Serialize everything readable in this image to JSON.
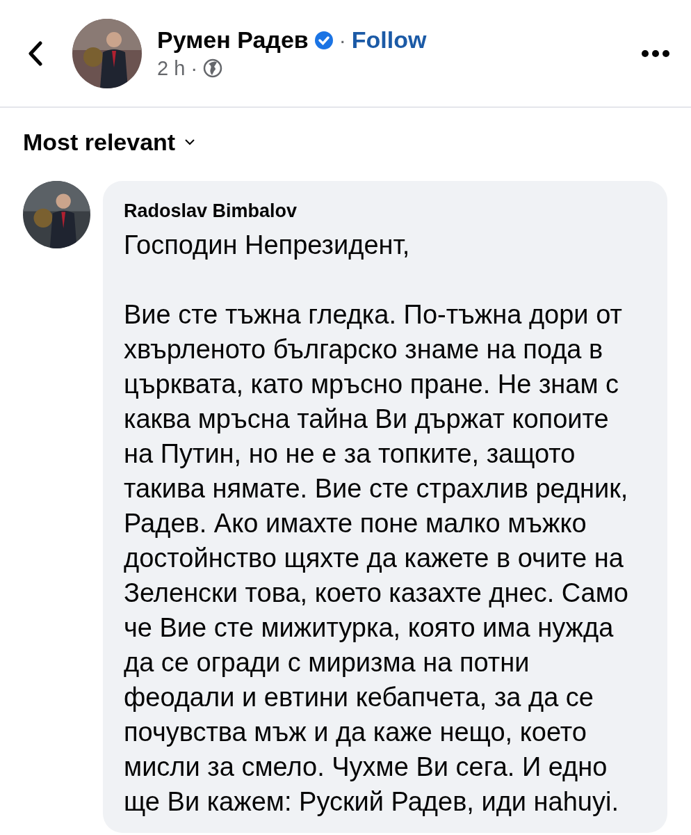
{
  "post_header": {
    "author": "Румен Радев",
    "verified": true,
    "separator": "·",
    "follow": "Follow",
    "time": "2 h",
    "time_separator": "·",
    "avatar": {
      "kind": "picture"
    }
  },
  "sort": {
    "label": "Most relevant"
  },
  "comments": [
    {
      "author": "Radoslav Bimbalov",
      "avatar": {
        "kind": "picture"
      },
      "paragraphs": [
        [
          "Господин Непрезидент,"
        ],
        [
          "Вие сте тъжна гледка. По-тъжна дори от",
          "хвърленото българско знаме на пода в",
          "църквата, като мръсно пране. Не знам с",
          "каква мръсна тайна Ви държат копоите",
          "на Путин, но не е за топките, защото",
          "такива нямате. Вие сте страхлив редник,",
          "Радев. Ако имахте поне малко мъжко",
          "достойнство щяхте да кажете в очите на",
          "Зеленски това, което казахте днес. Само",
          "че Вие сте мижитурка, която има нужда",
          "да се огради с миризма на потни",
          "феодали и евтини кебапчета, за да се",
          "почувства мъж и да каже нещо, което",
          "мисли за смело. Чухме Ви сега. И едно",
          "ще Ви кажем: Руский Радев, иди наhuyi."
        ]
      ]
    }
  ]
}
